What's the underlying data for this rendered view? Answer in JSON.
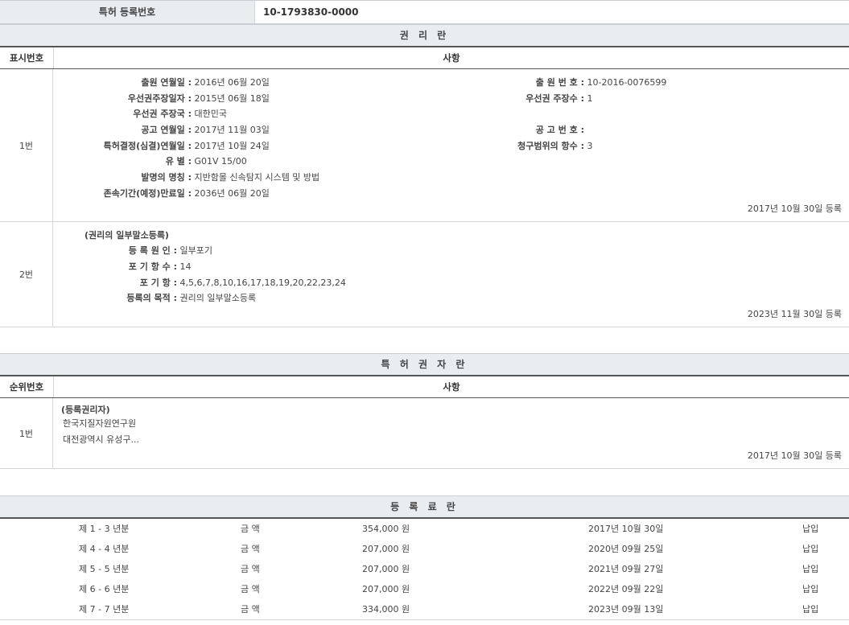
{
  "header": {
    "label": "특허 등록번호",
    "value": "10-1793830-0000"
  },
  "rights": {
    "title": "권 리 란",
    "col_num": "표시번호",
    "col_desc": "사항",
    "row1": {
      "num": "1번",
      "left": [
        {
          "k": "출원 연월일 :",
          "v": "2016년 06월 20일"
        },
        {
          "k": "우선권주장일자 :",
          "v": "2015년 06월 18일"
        },
        {
          "k": "우선권 주장국 :",
          "v": "대한민국"
        },
        {
          "k": "공고 연월일 :",
          "v": "2017년 11월 03일"
        },
        {
          "k": "특허결정(심결)연월일 :",
          "v": "2017년 10월 24일"
        },
        {
          "k": "유 별 :",
          "v": "G01V 15/00"
        },
        {
          "k": "발명의 명칭 :",
          "v": "지반함몰 신속탐지 시스템 및 방법"
        },
        {
          "k": "존속기간(예정)만료일 :",
          "v": "2036년 06월 20일"
        }
      ],
      "right": [
        {
          "k": "출 원 번 호 :",
          "v": "10-2016-0076599"
        },
        {
          "k": "우선권 주장수 :",
          "v": "1"
        },
        {
          "k": "",
          "v": ""
        },
        {
          "k": "공 고 번 호 :",
          "v": ""
        },
        {
          "k": "청구범위의 항수 :",
          "v": "3"
        }
      ],
      "date": "2017년 10월 30일 등록"
    },
    "row2": {
      "num": "2번",
      "heading": "(권리의 일부말소등록)",
      "items": [
        {
          "k": "등 록 원 인 :",
          "v": "일부포기"
        },
        {
          "k": "포 기 항 수 :",
          "v": "14"
        },
        {
          "k": "포 기 항 :",
          "v": "4,5,6,7,8,10,16,17,18,19,20,22,23,24"
        },
        {
          "k": "등록의 목적 :",
          "v": "권리의 일부말소등록"
        }
      ],
      "date": "2023년 11월 30일 등록"
    }
  },
  "holders": {
    "title": "특 허 권 자 란",
    "col_num": "순위번호",
    "col_desc": "사항",
    "row1": {
      "num": "1번",
      "heading": "(등록권리자)",
      "name": "한국지질자원연구원",
      "address": "대전광역시 유성구...",
      "date": "2017년 10월 30일 등록"
    }
  },
  "fees": {
    "title": "등 록 료 란",
    "rows": [
      {
        "period": "제 1 - 3 년분",
        "label": "금 액",
        "amount": "354,000 원",
        "date": "2017년 10월 30일",
        "status": "납입"
      },
      {
        "period": "제 4 - 4 년분",
        "label": "금 액",
        "amount": "207,000 원",
        "date": "2020년 09월 25일",
        "status": "납입"
      },
      {
        "period": "제 5 - 5 년분",
        "label": "금 액",
        "amount": "207,000 원",
        "date": "2021년 09월 27일",
        "status": "납입"
      },
      {
        "period": "제 6 - 6 년분",
        "label": "금 액",
        "amount": "207,000 원",
        "date": "2022년 09월 22일",
        "status": "납입"
      },
      {
        "period": "제 7 - 7 년분",
        "label": "금 액",
        "amount": "334,000 원",
        "date": "2023년 09월 13일",
        "status": "납입"
      }
    ]
  }
}
